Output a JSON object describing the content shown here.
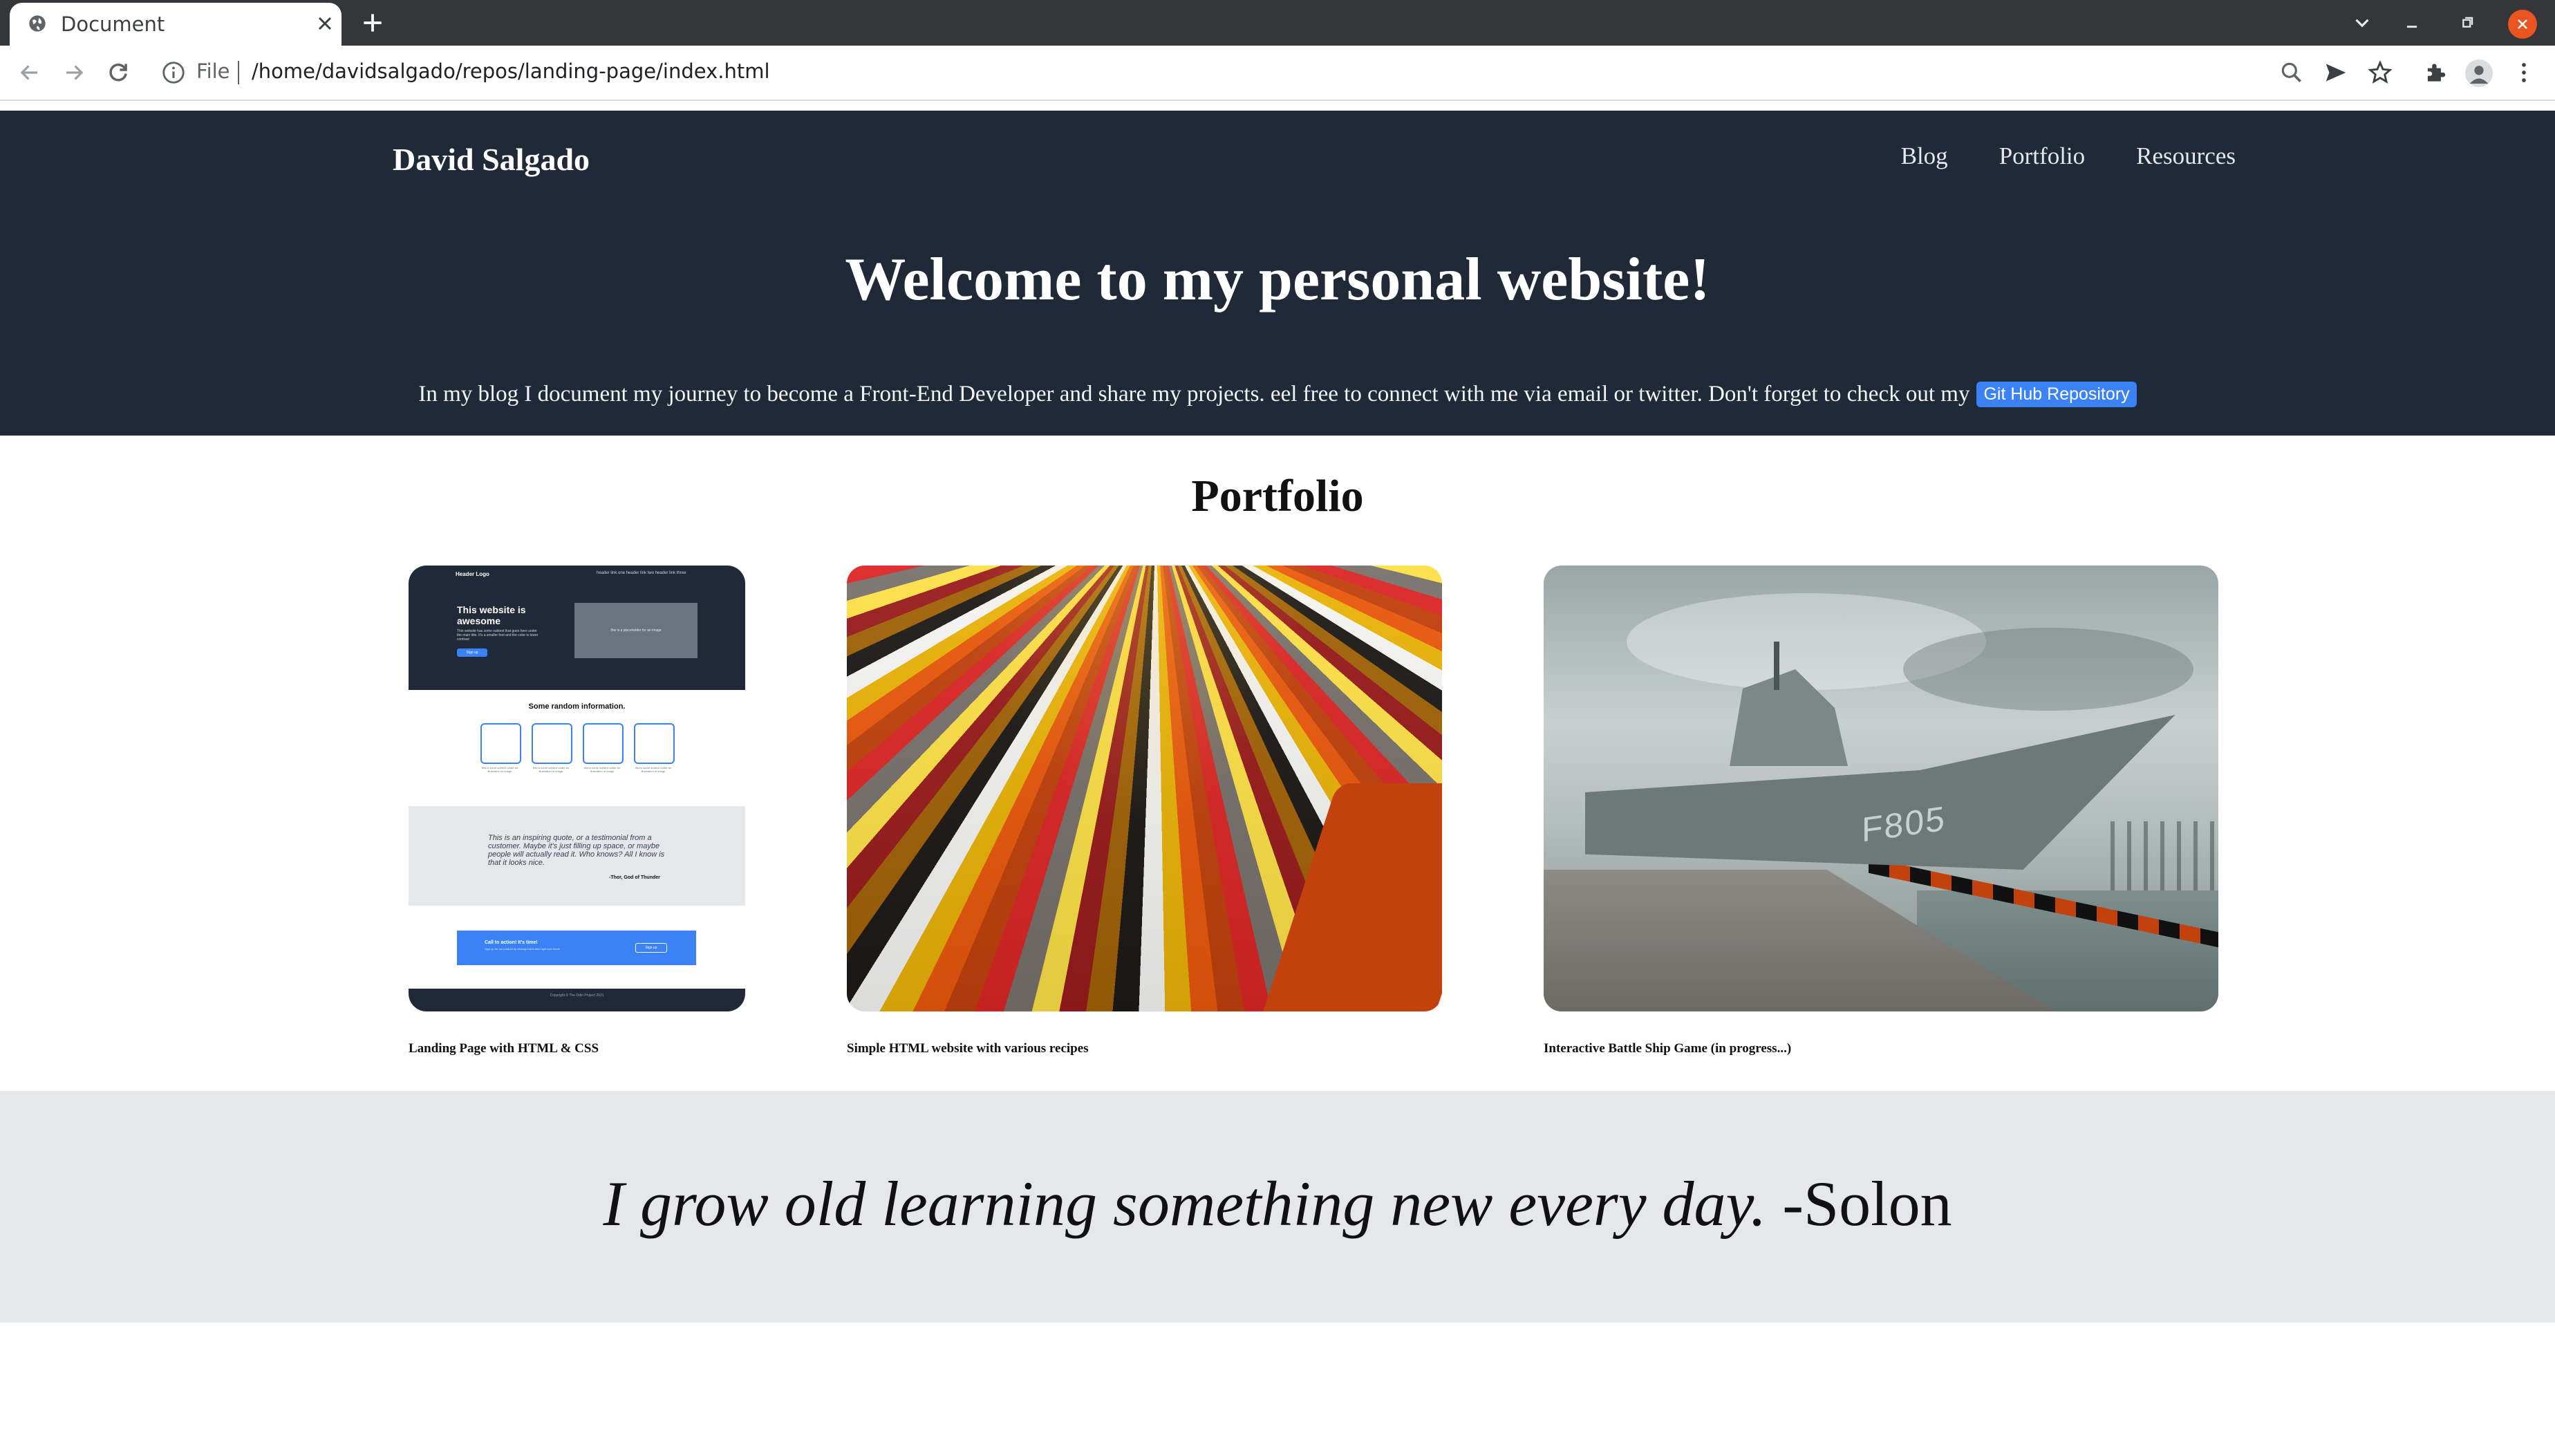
{
  "browser": {
    "tab_title": "Document",
    "omnibox": {
      "scheme_label": "File",
      "url": "/home/davidsalgado/repos/landing-page/index.html"
    }
  },
  "header": {
    "logo": "David Salgado",
    "nav": [
      "Blog",
      "Portfolio",
      "Resources"
    ]
  },
  "hero": {
    "title": "Welcome to my personal website!",
    "text": "In my blog I document my journey to become a Front-End Developer and share my projects. eel free to connect with me via email or twitter. Don't forget to check out my",
    "button_label": "Git Hub Repository"
  },
  "portfolio": {
    "heading": "Portfolio",
    "cards": [
      {
        "caption": "Landing Page with HTML & CSS",
        "thumb": {
          "logo": "Header Logo",
          "nav": "header link one    header link two    header link three",
          "hero_title": "This website is awesome",
          "hero_sub": "This website has some subtext that goes here under the main title. It's a smaller font and the color is lower contrast",
          "hero_button": "Sign up",
          "placeholder": "this is a placeholder for an image",
          "info_title": "Some random information.",
          "box_text": "this is some subtext under an illustration or image",
          "quote": "This is an inspiring quote, or a testimonial from a customer. Maybe it's just filling up space, or maybe people will actually read it. Who knows? All I know is that it looks nice.",
          "quote_author": "-Thor, God of Thunder",
          "cta_title": "Call to action! It's time!",
          "cta_sub": "Sign up for our product by clicking that button right over there!",
          "cta_button": "Sign up",
          "footer": "Copyright © The Odin Project 2021"
        }
      },
      {
        "caption": "Simple HTML website with various recipes"
      },
      {
        "caption": "Interactive Battle Ship Game (in progress...)",
        "ship_marking": "F805"
      }
    ]
  },
  "quote": {
    "text": "I grow old learning something new every day.",
    "author": "-Solon"
  },
  "colors": {
    "hero_bg": "#1f2937",
    "accent": "#3b82f6",
    "quote_bg": "#e5e7eb",
    "tabstrip_bg": "#35363a",
    "window_close": "#e95420"
  }
}
